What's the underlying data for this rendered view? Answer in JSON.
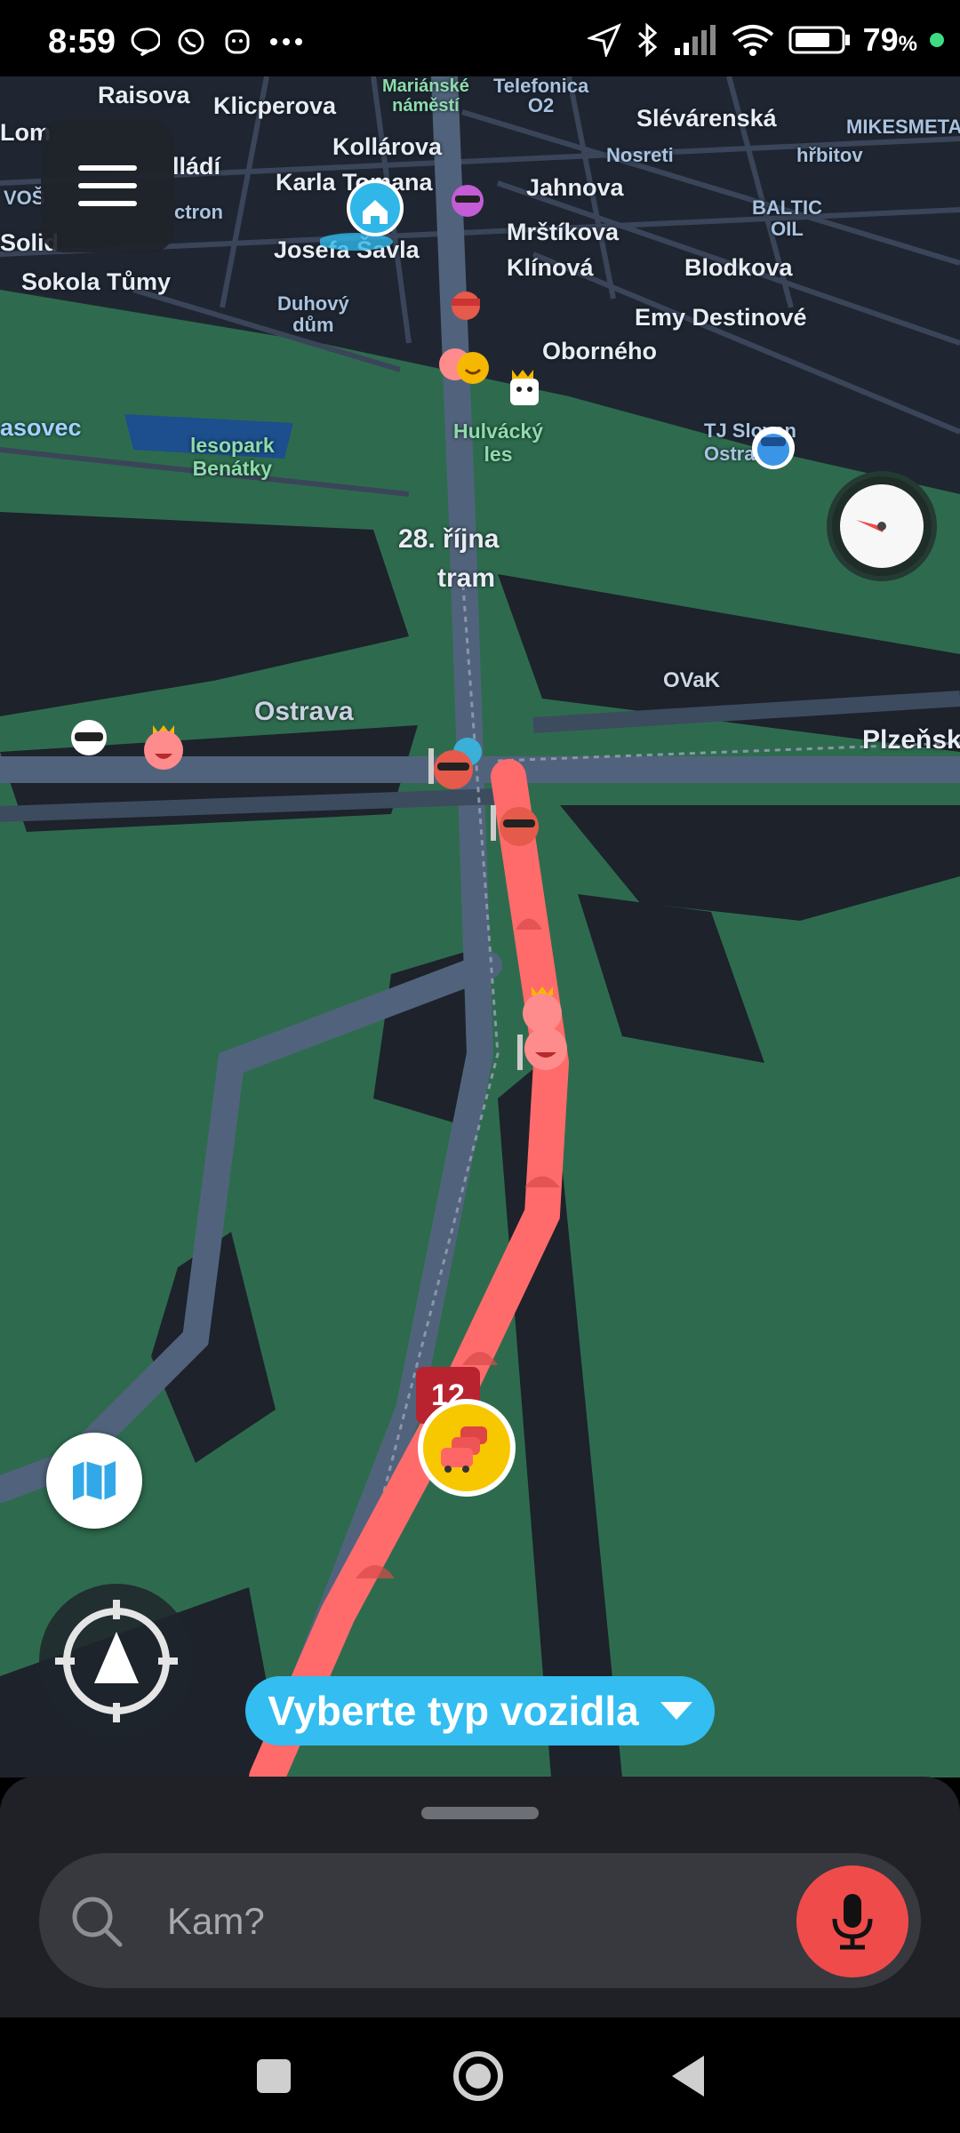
{
  "status_bar": {
    "time": "8:59",
    "battery_percent": "79",
    "battery_unit": "%",
    "left_icons": [
      "chat-bubble-icon",
      "whatsapp-icon",
      "app-icon",
      "more-dots-icon"
    ],
    "right_icons": [
      "location-arrow-icon",
      "bluetooth-icon",
      "signal-icon",
      "wifi-icon",
      "battery-icon"
    ]
  },
  "map": {
    "place_labels": {
      "raisova": "Raisova",
      "klicperova": "Klicperova",
      "marianske": "Mariánské\nnáměstí",
      "telefonica": "Telefonica\nO2",
      "slevarenska": "Slévárenská",
      "mikesmeta": "MIKESMETA",
      "lom": "Lom",
      "lladi": "lládí",
      "kollarova": "Kollárova",
      "nosreti": "Nosreti",
      "hrbitov": "hřbitov",
      "karla_tomana": "Karla Tomana",
      "jahnova": "Jahnova",
      "vos": "VOŠ",
      "ctron": "ctron",
      "mrstikova": "Mrštíkova",
      "baltic": "BALTIC\nOIL",
      "solid": "Solid",
      "josefa_savla": "Josefa Šavla",
      "klinova": "Klínová",
      "blodkova": "Blodkova",
      "sokola_tumy": "Sokola Tůmy",
      "duhovy_dum": "Duhový\ndům",
      "emy_destinove": "Emy Destinové",
      "oborneho": "Oborného",
      "asovec": "asovec",
      "lesopark": "lesopark\nBenátky",
      "hulvacky": "Hulvácký\nles",
      "tj_slovan": "TJ Slovan\nOstrava",
      "rijna_1": "28. října",
      "rijna_2": "tram",
      "ovak": "OVaK",
      "ostrava": "Ostrava",
      "plzenska": "Plzeňská"
    },
    "traffic_badge": "12",
    "route_color": "#ff6b6b",
    "park_color": "#2e6b4e",
    "ground_color": "#1d222b"
  },
  "vehicle_chip": {
    "label": "Vyberte typ vozidla"
  },
  "search": {
    "placeholder": "Kam?"
  },
  "nav": {
    "buttons": [
      "recent-apps",
      "home",
      "back"
    ]
  }
}
